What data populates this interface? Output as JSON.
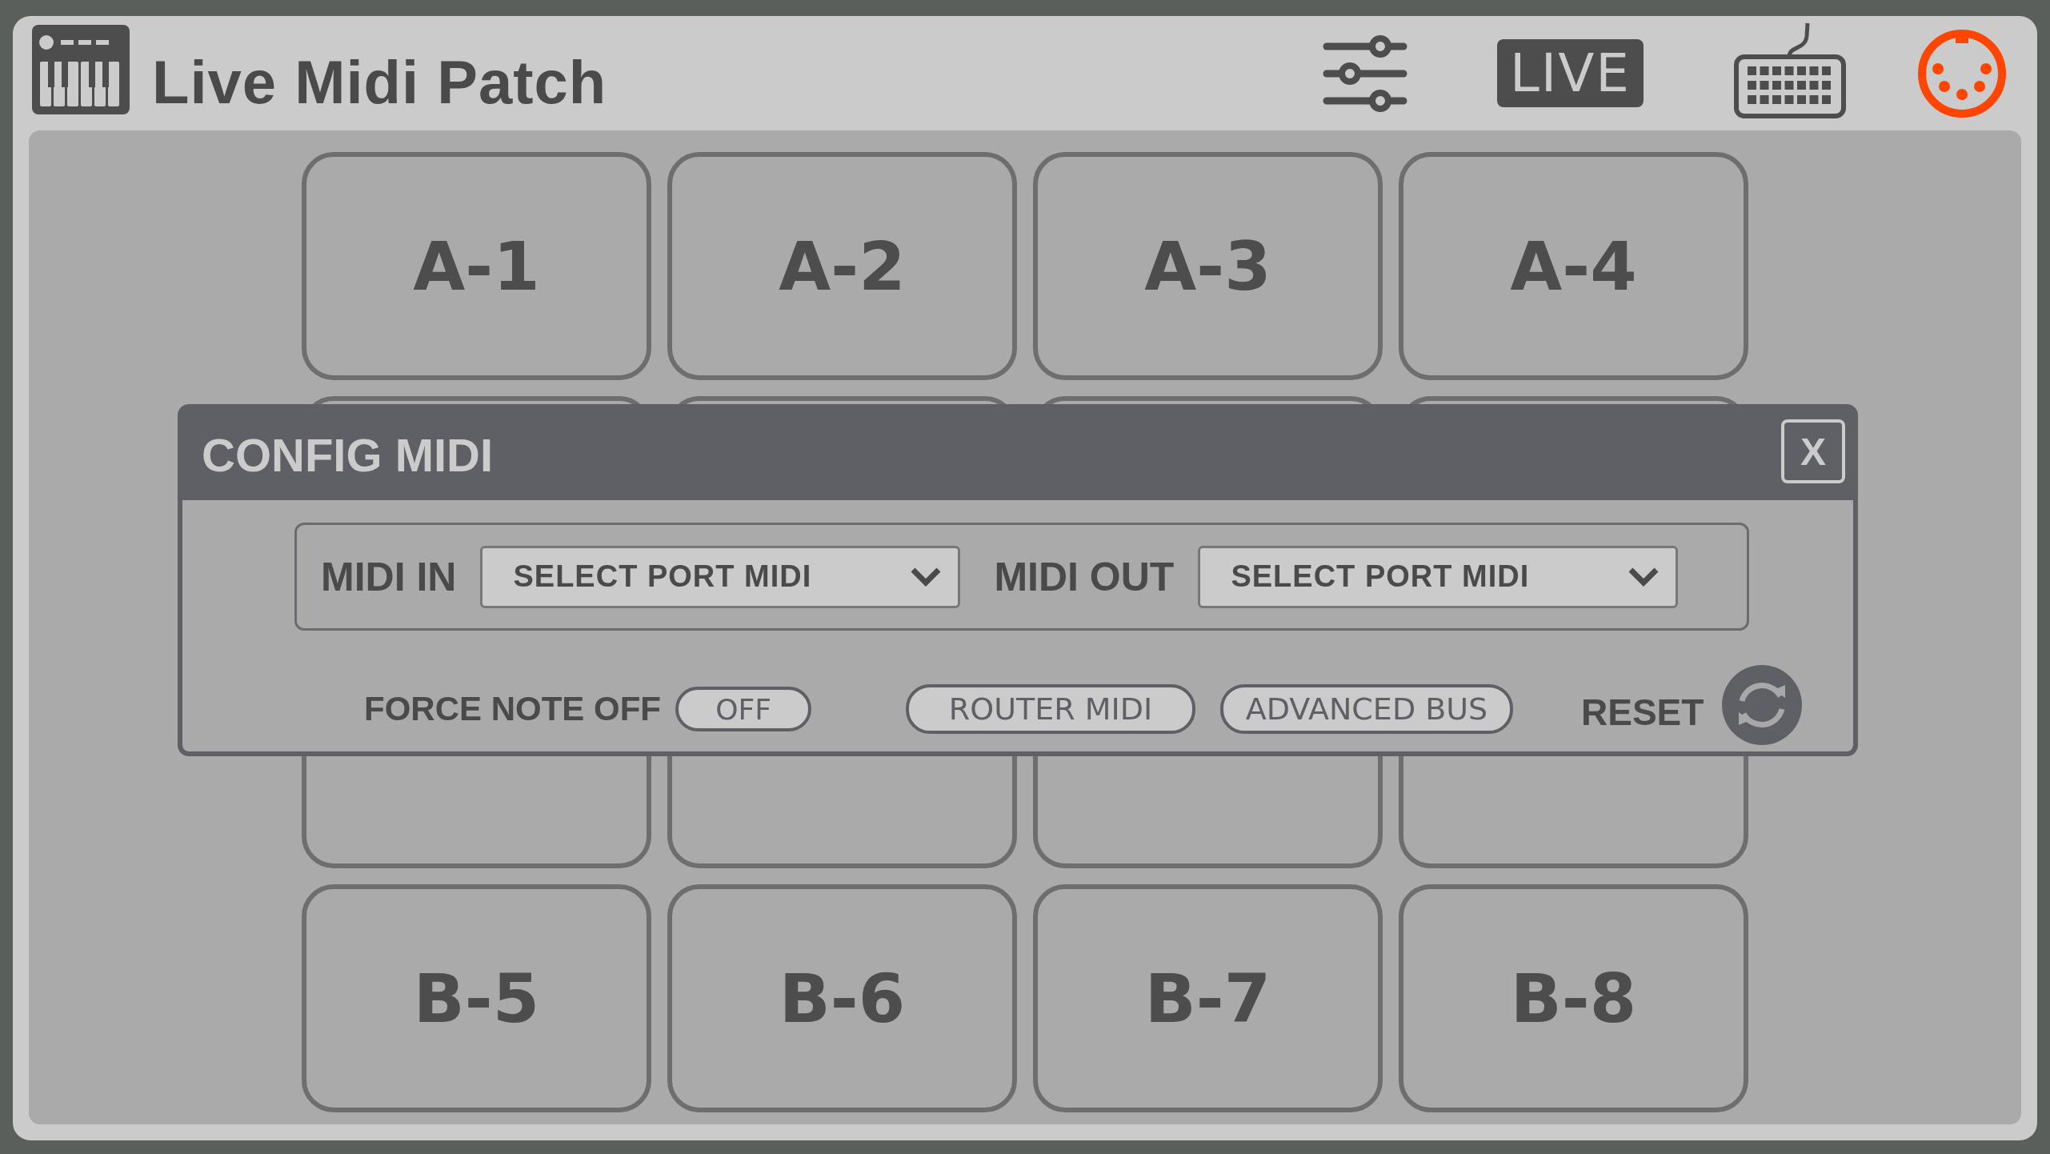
{
  "header": {
    "title": "Live Midi Patch",
    "live_label": "LIVE"
  },
  "top_pads": [
    "A-1",
    "A-2",
    "A-3",
    "A-4"
  ],
  "bottom_pads": [
    "B-5",
    "B-6",
    "B-7",
    "B-8"
  ],
  "dialog": {
    "title": "CONFIG MIDI",
    "close": "X",
    "ports": [
      {
        "label": "MIDI IN",
        "value": "SELECT PORT MIDI"
      },
      {
        "label": "MIDI OUT",
        "value": "SELECT PORT MIDI"
      }
    ],
    "force_note_off": {
      "label": "FORCE NOTE OFF",
      "toggle": "OFF",
      "on": false
    },
    "buttons": [
      "ROUTER MIDI",
      "ADVANCED BUS"
    ],
    "reset": "RESET"
  }
}
